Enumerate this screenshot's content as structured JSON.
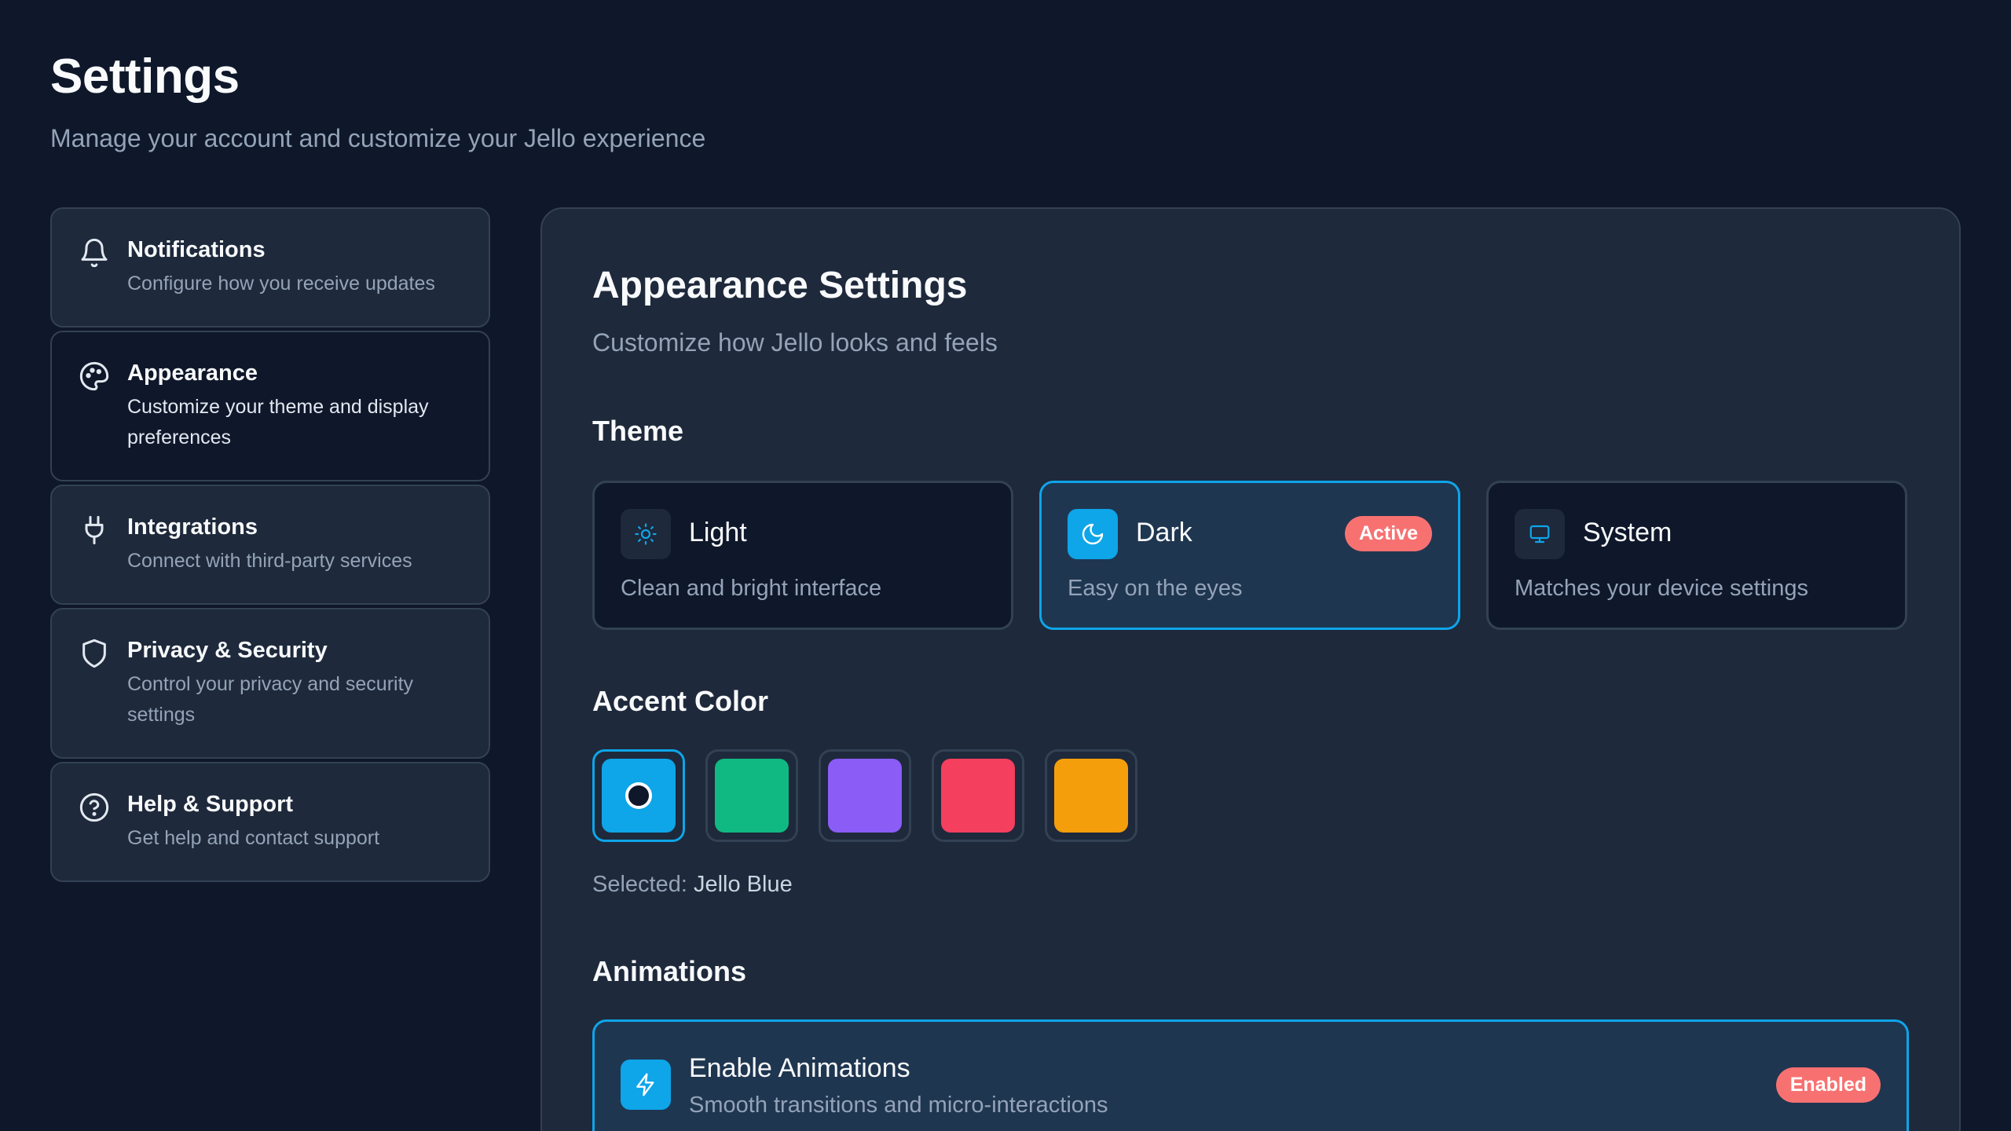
{
  "header": {
    "title": "Settings",
    "subtitle": "Manage your account and customize your Jello experience"
  },
  "sidebar": {
    "items": [
      {
        "icon": "bell-icon",
        "title": "Notifications",
        "description": "Configure how you receive updates",
        "active": false
      },
      {
        "icon": "palette-icon",
        "title": "Appearance",
        "description": "Customize your theme and display preferences",
        "active": true
      },
      {
        "icon": "plug-icon",
        "title": "Integrations",
        "description": "Connect with third-party services",
        "active": false
      },
      {
        "icon": "shield-icon",
        "title": "Privacy & Security",
        "description": "Control your privacy and security settings",
        "active": false
      },
      {
        "icon": "help-circle-icon",
        "title": "Help & Support",
        "description": "Get help and contact support",
        "active": false
      }
    ]
  },
  "main": {
    "title": "Appearance Settings",
    "subtitle": "Customize how Jello looks and feels",
    "theme": {
      "section_title": "Theme",
      "options": [
        {
          "icon": "sun-icon",
          "name": "Light",
          "description": "Clean and bright interface"
        },
        {
          "icon": "moon-icon",
          "name": "Dark",
          "description": "Easy on the eyes",
          "badge": "Active"
        },
        {
          "icon": "monitor-icon",
          "name": "System",
          "description": "Matches your device settings"
        }
      ]
    },
    "accent": {
      "section_title": "Accent Color",
      "colors": [
        "#0ea5e9",
        "#10b981",
        "#8b5cf6",
        "#f43f5e",
        "#f59e0b"
      ],
      "selected_label": "Selected:",
      "selected_value": "Jello Blue"
    },
    "animations": {
      "section_title": "Animations",
      "title": "Enable Animations",
      "description": "Smooth transitions and micro-interactions",
      "badge": "Enabled"
    }
  },
  "colors": {
    "background": "#0f172a",
    "surface": "#1e293b",
    "accent": "#0ea5e9",
    "badge": "#f87171"
  }
}
